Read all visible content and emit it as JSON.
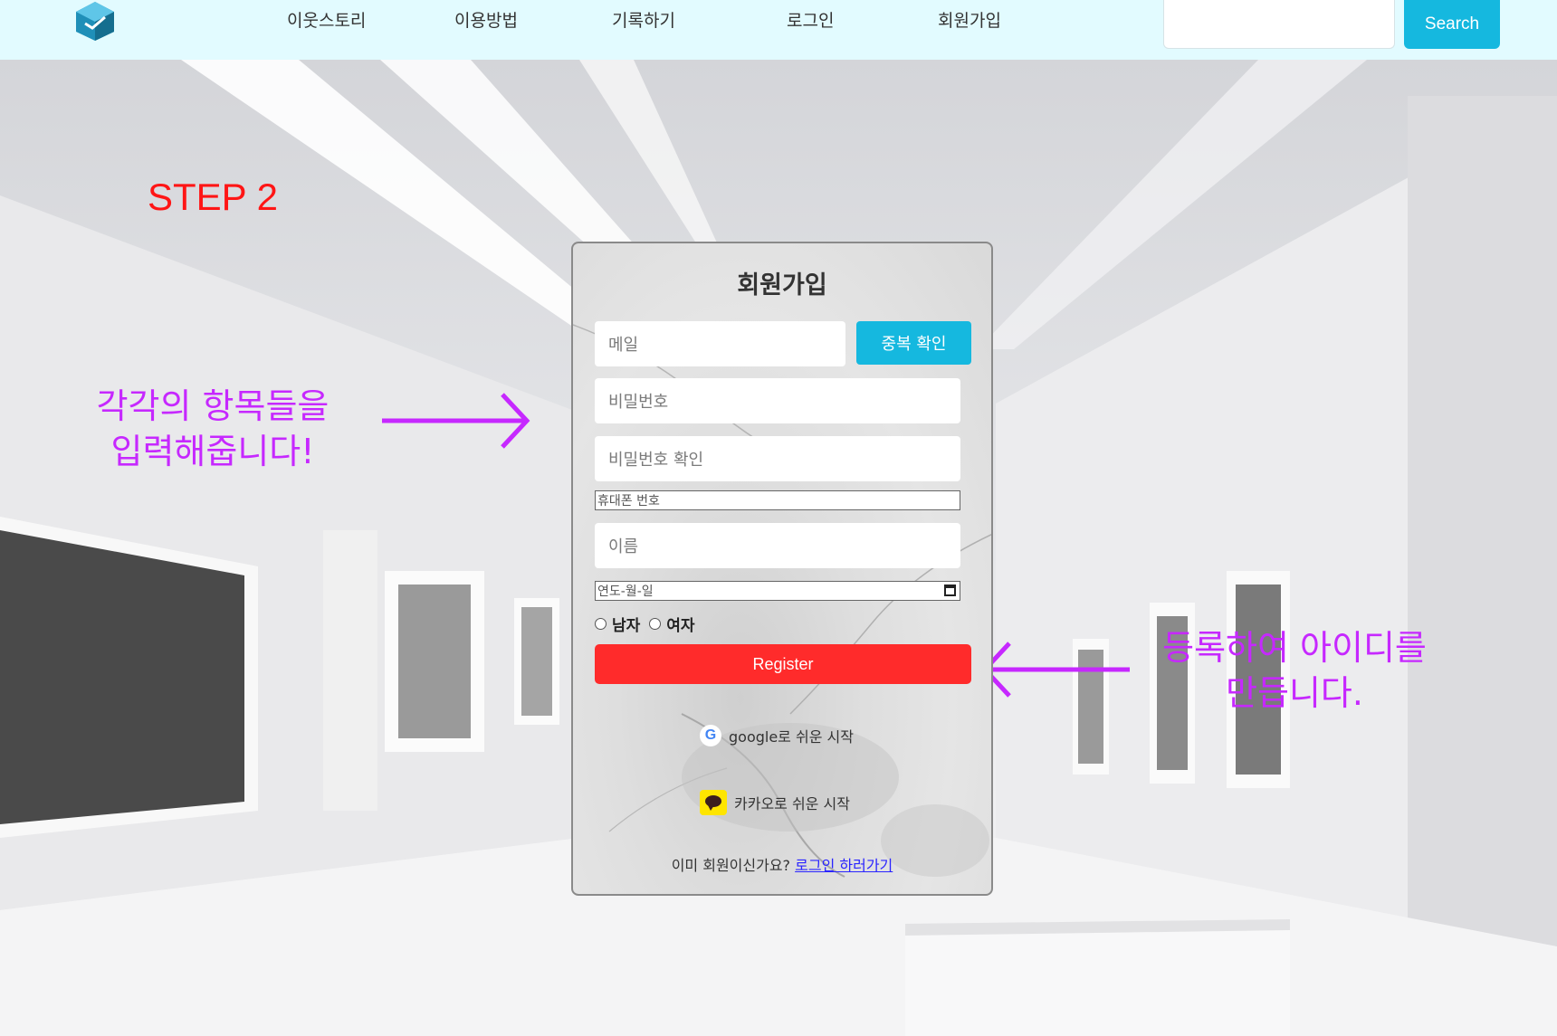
{
  "header": {
    "nav": [
      "이웃스토리",
      "이용방법",
      "기록하기",
      "로그인",
      "회원가입"
    ],
    "search_button": "Search",
    "search_placeholder": ""
  },
  "annotations": {
    "step": "STEP 2",
    "left_line1": "각각의 항목들을",
    "left_line2": "입력해줍니다!",
    "right_line1": "등록하여 아이디를",
    "right_line2": "만듭니다."
  },
  "form": {
    "title": "회원가입",
    "email_placeholder": "메일",
    "duplicate_check": "중복 확인",
    "password_placeholder": "비밀번호",
    "password_confirm_placeholder": "비밀번호 확인",
    "phone_placeholder": "휴대폰 번호",
    "name_placeholder": "이름",
    "date_placeholder": "연도-월-일",
    "gender_male": "남자",
    "gender_female": "여자",
    "register_button": "Register",
    "google_start": "google로 쉬운 시작",
    "kakao_start": "카카오로 쉬운 시작",
    "already_member": "이미 회원이신가요?",
    "login_link": "로그인 하러가기"
  },
  "colors": {
    "header_bg": "#e2fbff",
    "accent_blue": "#15b8df",
    "register_red": "#ff2b2b",
    "annotation_purple": "#c628ff",
    "step_red": "#ff1515",
    "link_blue": "#2a24ff"
  }
}
